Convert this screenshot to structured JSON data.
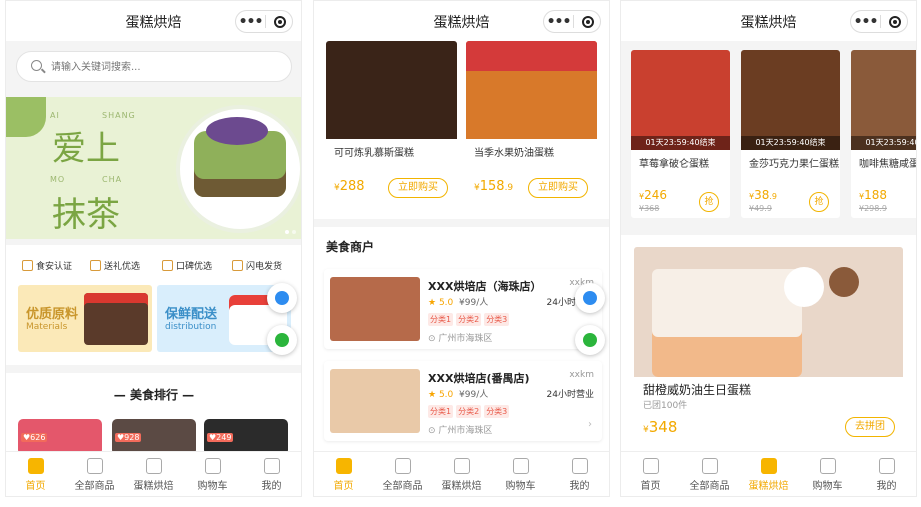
{
  "app_title": "蛋糕烘焙",
  "capsule": {
    "more": "•••"
  },
  "tabs": [
    {
      "label": "首页",
      "icon": "home-icon"
    },
    {
      "label": "全部商品",
      "icon": "grid-icon"
    },
    {
      "label": "蛋糕烘焙",
      "icon": "gift-icon"
    },
    {
      "label": "购物车",
      "icon": "cart-icon"
    },
    {
      "label": "我的",
      "icon": "user-icon"
    }
  ],
  "screen1": {
    "search_placeholder": "请输入关键词搜索...",
    "banner": {
      "lat1": "AI",
      "lat2": "SHANG",
      "lat3": "MO",
      "lat4": "CHA",
      "big1": "爱上",
      "big2": "抹茶"
    },
    "features": [
      "食安认证",
      "送礼优选",
      "口碑优选",
      "闪电发货"
    ],
    "promos": [
      {
        "title": "优质原料",
        "sub": "Materials"
      },
      {
        "title": "保鲜配送",
        "sub": "distribution"
      }
    ],
    "ranking_title": "美食排行",
    "ranking": [
      {
        "count": "626"
      },
      {
        "count": "928"
      },
      {
        "count": "249"
      }
    ]
  },
  "screen2": {
    "products": [
      {
        "name": "可可炼乳慕斯蛋糕",
        "price_int": "288",
        "price_dec": "",
        "buy": "立即购买"
      },
      {
        "name": "当季水果奶油蛋糕",
        "price_int": "158",
        "price_dec": ".9",
        "buy": "立即购买"
      }
    ],
    "merchants_title": "美食商户",
    "merchants": [
      {
        "name": "XXX烘培店（海珠店）",
        "dist": "xxkm",
        "rating": "5.0",
        "avg": "¥99/人",
        "hours": "24小时营业",
        "tags": [
          "分类1",
          "分类2",
          "分类3"
        ],
        "addr": "广州市海珠区"
      },
      {
        "name": "XXX烘培店(番禺店)",
        "dist": "xxkm",
        "rating": "5.0",
        "avg": "¥99/人",
        "hours": "24小时营业",
        "tags": [
          "分类1",
          "分类2",
          "分类3"
        ],
        "addr": "广州市海珠区"
      }
    ]
  },
  "screen3": {
    "flash": [
      {
        "countdown": "01天23:59:40结束",
        "name": "草莓拿破仑蛋糕",
        "price_int": "246",
        "price_dec": "",
        "orig": "¥368",
        "btn": "抢"
      },
      {
        "countdown": "01天23:59:40结束",
        "name": "金莎巧克力果仁蛋糕",
        "price_int": "38",
        "price_dec": ".9",
        "orig": "¥49.9",
        "btn": "抢"
      },
      {
        "countdown": "01天23:59:40结束",
        "name": "咖啡焦糖咸蛋糕",
        "price_int": "188",
        "price_dec": "",
        "orig": "¥298.9",
        "btn": "抢"
      }
    ],
    "group": {
      "name": "甜橙威奶油生日蛋糕",
      "sold": "已团100件",
      "price": "348",
      "btn": "去拼团"
    }
  },
  "colors": {
    "accent": "#f7b500",
    "price": "#f2a900",
    "tag": "#e85a4a"
  }
}
